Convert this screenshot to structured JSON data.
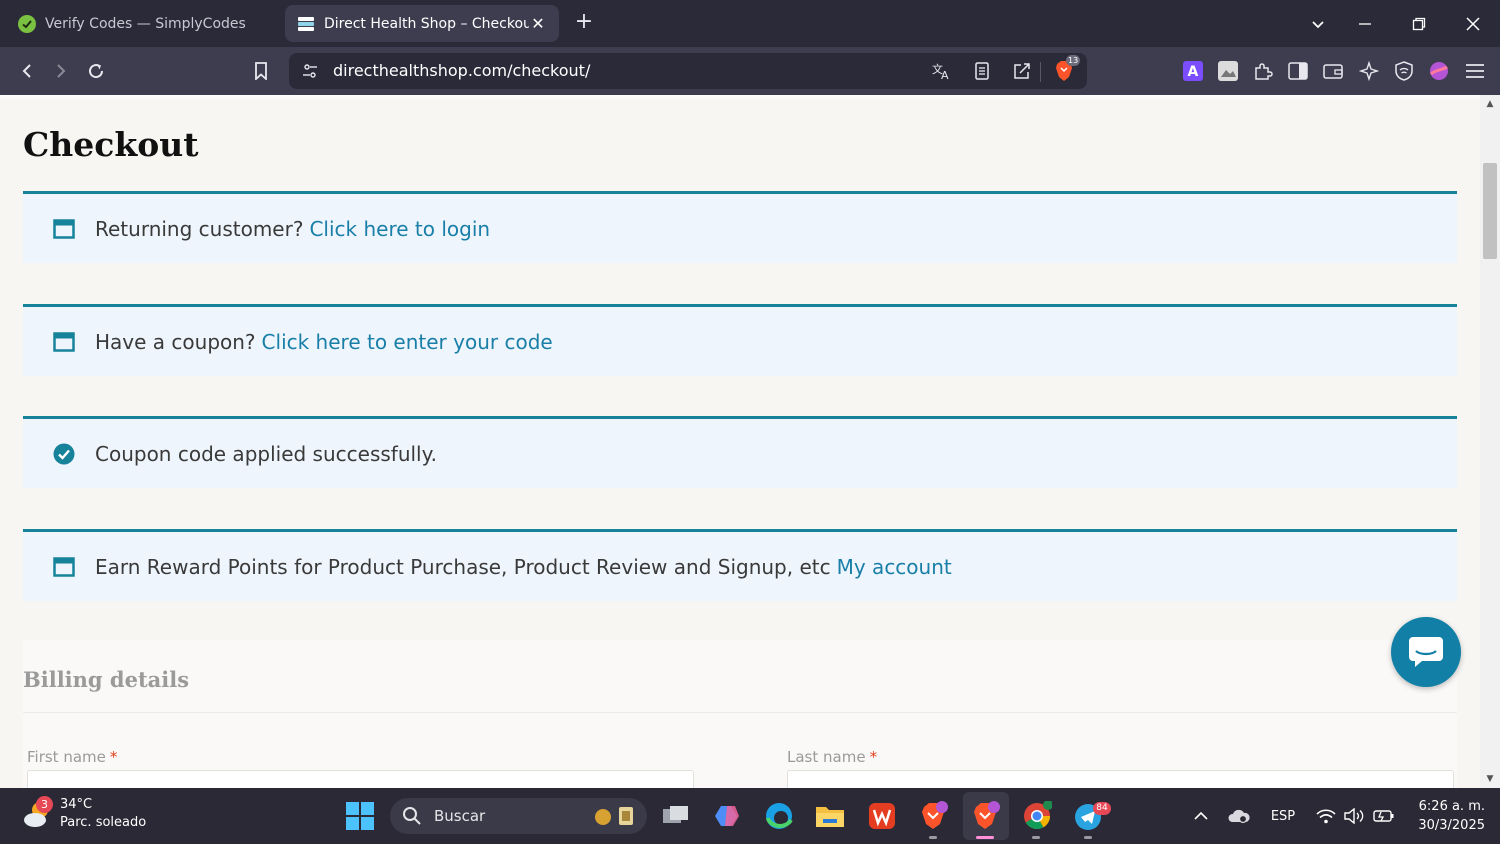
{
  "browser": {
    "tabs": [
      {
        "title": "Verify Codes — SimplyCodes",
        "active": false
      },
      {
        "title": "Direct Health Shop – Checkout",
        "active": true
      }
    ],
    "url": "directhealthshop.com/checkout/",
    "shield_count": "13"
  },
  "page": {
    "title": "Checkout",
    "notices": [
      {
        "text": "Returning customer?",
        "link": "Click here to login",
        "icon": "window-icon"
      },
      {
        "text": "Have a coupon?",
        "link": "Click here to enter your code",
        "icon": "window-icon"
      },
      {
        "text": "Coupon code applied successfully.",
        "link": "",
        "icon": "check-circle-icon"
      },
      {
        "text": "Earn Reward Points for Product Purchase, Product Review and Signup, etc",
        "link": "My account",
        "icon": "window-icon"
      }
    ],
    "billing": {
      "title": "Billing details",
      "first_name_label": "First name",
      "last_name_label": "Last name",
      "required_mark": "*"
    }
  },
  "taskbar": {
    "weather": {
      "temp": "34°C",
      "desc": "Parc. soleado",
      "badge": "3"
    },
    "search_placeholder": "Buscar",
    "telegram_badge": "84",
    "language": "ESP",
    "time": "6:26 a. m.",
    "date": "30/3/2025"
  },
  "colors": {
    "accent_teal": "#17839b",
    "link_blue": "#1a7fa8",
    "notice_bg": "#eef5fc",
    "chat_bubble": "#127fa6",
    "required_red": "#e2401c"
  }
}
